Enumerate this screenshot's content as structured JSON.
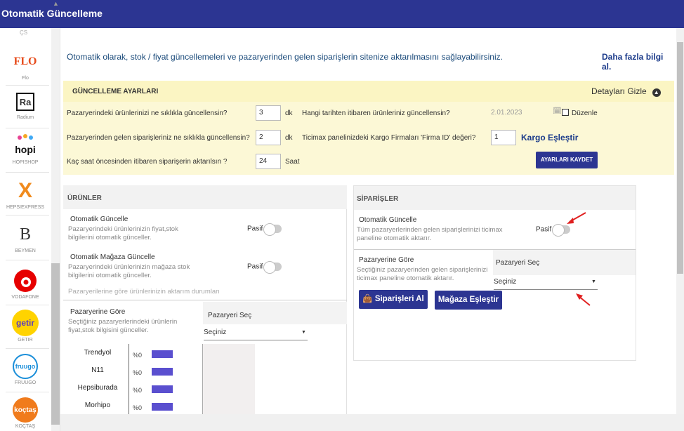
{
  "window": {
    "title": "Otomatik Güncelleme"
  },
  "sidebar": {
    "top_label": "ÇS",
    "brands": [
      {
        "name": "Flo",
        "logo_text": "FLO",
        "color": "#e74c1c"
      },
      {
        "name": "Radium",
        "logo_text": "Ra",
        "color": "#111111"
      },
      {
        "name": "HOPISHOP",
        "logo_text": "hopi",
        "color": "#111111"
      },
      {
        "name": "HEPSIEXPRESS",
        "logo_text": "X",
        "color": "#f08a1c"
      },
      {
        "name": "BEYMEN",
        "logo_text": "B",
        "color": "#111111"
      },
      {
        "name": "VODAFONE",
        "logo_text": "",
        "color": "#e60000"
      },
      {
        "name": "GETIR",
        "logo_text": "getir",
        "color": "#5d3ebc"
      },
      {
        "name": "FRUUGO",
        "logo_text": "fruugo",
        "color": "#1a8ed9"
      },
      {
        "name": "KOÇTAŞ",
        "logo_text": "koçtaş",
        "color": "#f07b1c"
      }
    ]
  },
  "intro": {
    "text": "Otomatik olarak, stok / fiyat güncellemeleri ve pazaryerinden gelen siparişlerin sitenize aktarılmasını sağlayabilirsiniz.",
    "more_link": "Daha fazla bilgi al."
  },
  "settings": {
    "title": "GÜNCELLEME AYARLARI",
    "details_toggle": "Detayları Gizle",
    "q1": "Pazaryerindeki ürünlerinizi ne sıklıkla güncellensin?",
    "q1_value": "3",
    "q1_unit": "dk",
    "q2": "Pazaryerinden gelen siparişleriniz ne sıklıkla güncellensin?",
    "q2_value": "2",
    "q2_unit": "dk",
    "q3": "Kaç saat öncesinden itibaren siparişerin aktarılsın ?",
    "q3_value": "24",
    "q3_unit": "Saat",
    "q4": "Hangi tarihten itibaren ürünleriniz güncellensin?",
    "q4_value": "2.01.2023",
    "edit_label": "Düzenle",
    "q5": "Ticimax panelinizdeki Kargo Firmaları 'Firma ID' değeri?",
    "q5_value": "1",
    "cargo_link": "Kargo Eşleştir",
    "save_button": "AYARLARI KAYDET"
  },
  "urunler": {
    "title": "ÜRÜNLER",
    "auto_update": {
      "label": "Otomatik Güncelle",
      "desc": "Pazaryerindeki ürünlerinizin fiyat,stok bilgilerini otomatik günceller.",
      "state": "Pasif"
    },
    "store_update": {
      "label": "Otomatik Mağaza Güncelle",
      "desc": "Pazaryerindeki ürünlerinizin mağaza stok bilgilerini otomatik günceller.",
      "state": "Pasif"
    },
    "status_note": "Pazaryerilerine göre ürünlerinizin aktarım durumları",
    "by_marketplace": {
      "label": "Pazaryerine Göre",
      "desc": "Seçtiğiniz pazaryerlerindeki ürünlerin fiyat,stok bilgisini günceller.",
      "select_header": "Pazaryeri Seç",
      "select_value": "Seçiniz"
    },
    "marketplaces": [
      {
        "name": "Trendyol",
        "pct": "%0",
        "progress": 0
      },
      {
        "name": "N11",
        "pct": "%0",
        "progress": 0
      },
      {
        "name": "Hepsiburada",
        "pct": "%0",
        "progress": 0
      },
      {
        "name": "Morhipo",
        "pct": "%0",
        "progress": 0
      }
    ]
  },
  "siparisler": {
    "title": "SİPARİŞLER",
    "auto_update": {
      "label": "Otomatik Güncelle",
      "desc": "Tüm pazaryerlerinden gelen siparişlerinizi ticimax paneline otomatik aktarır.",
      "state": "Pasif"
    },
    "by_marketplace": {
      "label": "Pazaryerine Göre",
      "desc": "Seçtiğiniz pazaryerinden gelen siparişlerinizi ticimax paneline otomatik aktarır.",
      "select_header": "Pazaryeri Seç",
      "select_value": "Seçiniz"
    },
    "get_orders_button": "Siparişleri Al",
    "match_store_button": "Mağaza Eşleştir"
  },
  "colors": {
    "accent": "#2c3592",
    "settings_bg": "#fcf8d6",
    "bar": "#5a4fcf",
    "annotation": "#e02020"
  }
}
